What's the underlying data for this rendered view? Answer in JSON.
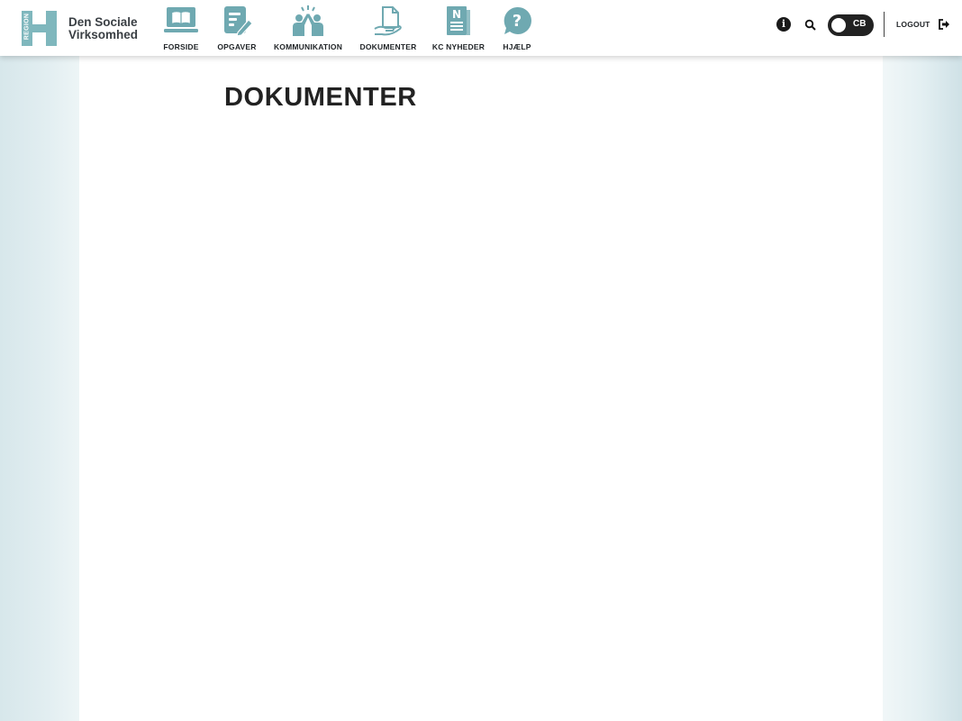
{
  "brand": {
    "vertical_text": "REGION",
    "line1": "Den Sociale",
    "line2": "Virksomhed",
    "color": "#7fb7bd"
  },
  "nav": {
    "accent_color": "#6fa9b1",
    "items": [
      {
        "label": "FORSIDE",
        "icon": "laptop-book-icon"
      },
      {
        "label": "OPGAVER",
        "icon": "task-edit-icon"
      },
      {
        "label": "KOMMUNIKATION",
        "icon": "people-highfive-icon"
      },
      {
        "label": "DOKUMENTER",
        "icon": "document-hand-icon"
      },
      {
        "label": "KC NYHEDER",
        "icon": "newspaper-icon"
      },
      {
        "label": "HJÆLP",
        "icon": "help-bubble-icon"
      }
    ]
  },
  "toolbar": {
    "info_symbol": "i",
    "toggle_label": "CB",
    "logout_label": "LOGOUT"
  },
  "page": {
    "title": "DOKUMENTER"
  }
}
